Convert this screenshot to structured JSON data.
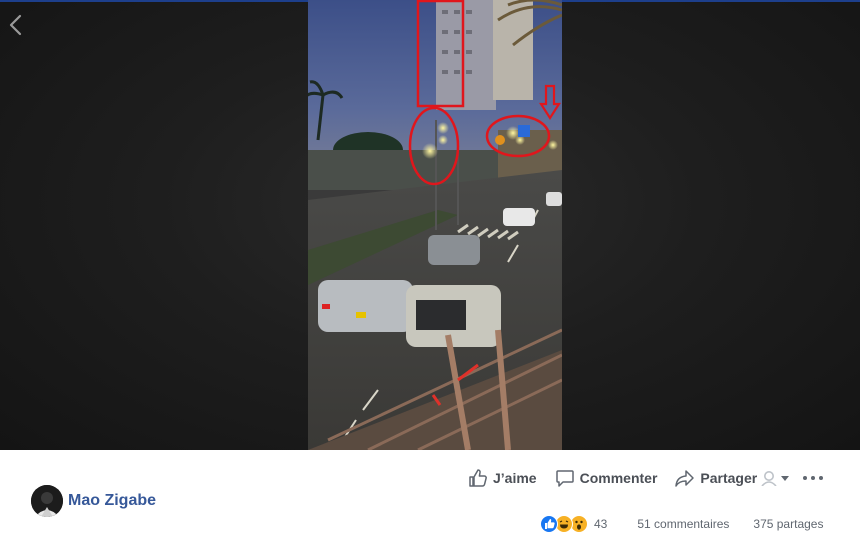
{
  "post": {
    "author_name": "Mao Zigabe"
  },
  "actions": {
    "like_label": "J’aime",
    "comment_label": "Commenter",
    "share_label": "Partager"
  },
  "stats": {
    "reaction_count": "43",
    "comments": "51 commentaires",
    "shares": "375 partages",
    "reaction_types": [
      "like",
      "haha",
      "wow"
    ]
  },
  "icons": {
    "back": "chevron-left-icon",
    "like": "thumbs-up-icon",
    "comment": "speech-bubble-icon",
    "share": "share-arrow-icon",
    "audience": "audience-selector-icon",
    "more": "more-options-icon"
  },
  "colors": {
    "author_link": "#365899",
    "action_text": "#4b4f56",
    "stats_text": "#606770",
    "like_blue": "#1877f2",
    "emoji_yellow": "#f7b125",
    "annotation_red": "#e0161c",
    "stage_bg": "#1e1e1e"
  }
}
